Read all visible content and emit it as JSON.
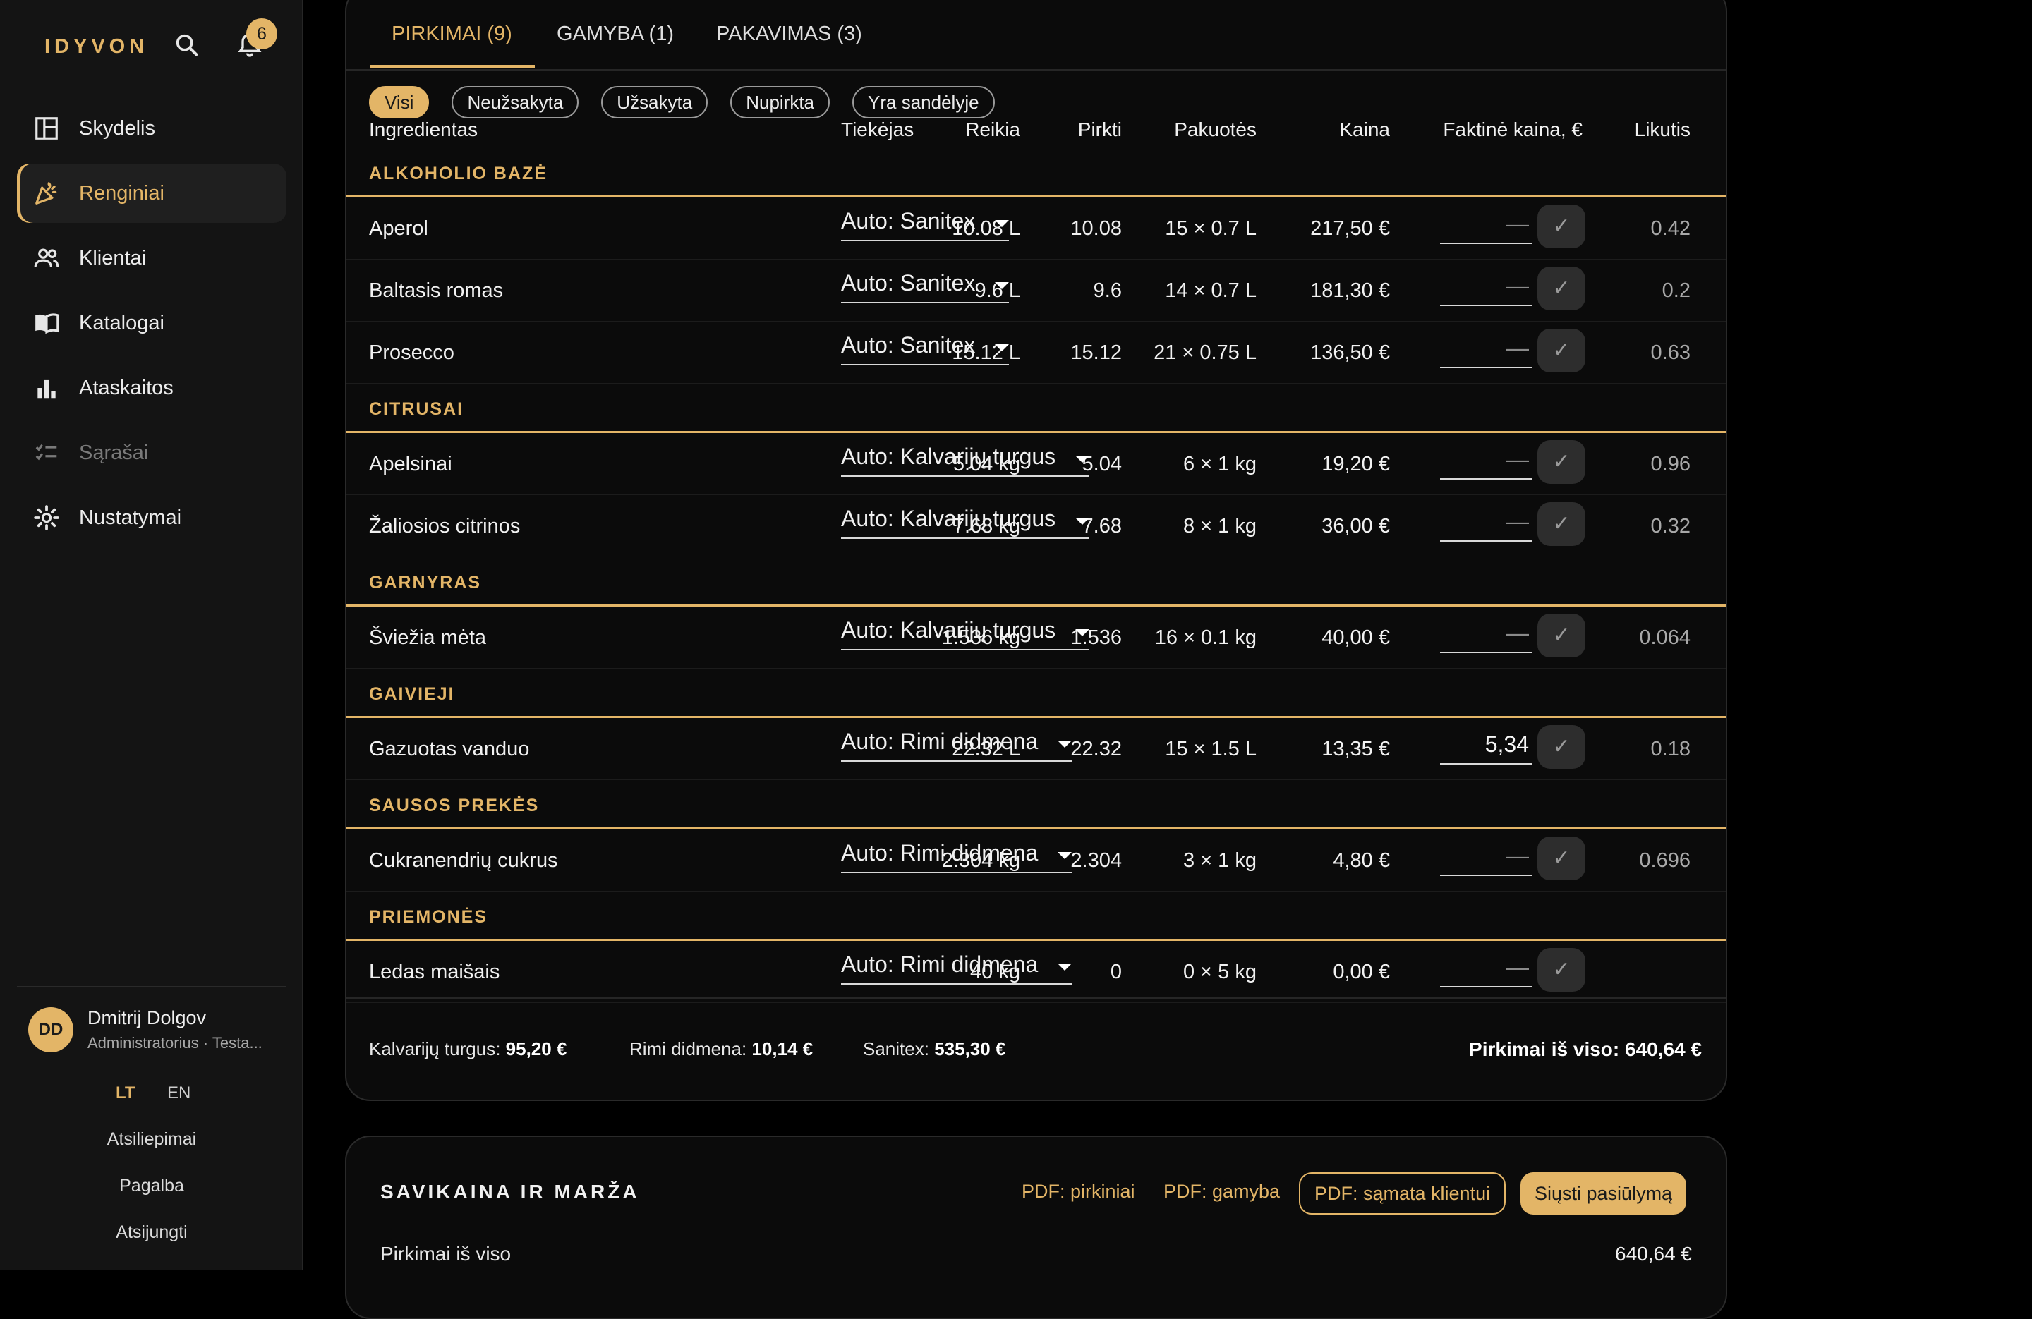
{
  "app": {
    "brand": "IDYVON",
    "notification_count": "6"
  },
  "sidebar": {
    "items": [
      {
        "label": "Skydelis",
        "icon": "dashboard-icon"
      },
      {
        "label": "Renginiai",
        "icon": "party-icon"
      },
      {
        "label": "Klientai",
        "icon": "users-icon"
      },
      {
        "label": "Katalogai",
        "icon": "book-icon"
      },
      {
        "label": "Ataskaitos",
        "icon": "bar-chart-icon"
      },
      {
        "label": "Sąrašai",
        "icon": "checklist-icon"
      },
      {
        "label": "Nustatymai",
        "icon": "gear-icon"
      }
    ],
    "active_index": 1,
    "disabled_index": 5
  },
  "user": {
    "initials": "DD",
    "name": "Dmitrij Dolgov",
    "role": "Administratorius · Testa..."
  },
  "lang": {
    "lt": "LT",
    "en": "EN",
    "active": "LT"
  },
  "links": {
    "feedback": "Atsiliepimai",
    "help": "Pagalba",
    "logout": "Atsijungti"
  },
  "tabs": [
    "PIRKIMAI (9)",
    "GAMYBA (1)",
    "PAKAVIMAS (3)"
  ],
  "filters": [
    "Visi",
    "Neužsakyta",
    "Užsakyta",
    "Nupirkta",
    "Yra sandėlyje"
  ],
  "table": {
    "headers": {
      "ingredient": "Ingredientas",
      "need": "Reikia",
      "buy": "Pirkti",
      "supplier": "Tiekėjas",
      "packs": "Pakuotės",
      "price": "Kaina",
      "actual": "Faktinė kaina, €",
      "rest": "Likutis"
    },
    "groups": [
      {
        "label": "ALKOHOLIO BAZĖ",
        "rows": [
          {
            "name": "Aperol",
            "need": "10.08 L",
            "buy": "10.08",
            "supplier": "Auto: Sanitex",
            "packs": "15 × 0.7 L",
            "price": "217,50 €",
            "actual": "—",
            "check": "✓",
            "rest": "0.42"
          },
          {
            "name": "Baltasis romas",
            "need": "9.6 L",
            "buy": "9.6",
            "supplier": "Auto: Sanitex",
            "packs": "14 × 0.7 L",
            "price": "181,30 €",
            "actual": "—",
            "check": "✓",
            "rest": "0.2"
          },
          {
            "name": "Prosecco",
            "need": "15.12 L",
            "buy": "15.12",
            "supplier": "Auto: Sanitex",
            "packs": "21 × 0.75 L",
            "price": "136,50 €",
            "actual": "—",
            "check": "✓",
            "rest": "0.63"
          }
        ]
      },
      {
        "label": "CITRUSAI",
        "rows": [
          {
            "name": "Apelsinai",
            "need": "5.04 kg",
            "buy": "5.04",
            "supplier": "Auto: Kalvarijų turgus",
            "packs": "6 × 1 kg",
            "price": "19,20 €",
            "actual": "—",
            "check": "✓",
            "rest": "0.96"
          },
          {
            "name": "Žaliosios citrinos",
            "need": "7.68 kg",
            "buy": "7.68",
            "supplier": "Auto: Kalvarijų turgus",
            "packs": "8 × 1 kg",
            "price": "36,00 €",
            "actual": "—",
            "check": "✓",
            "rest": "0.32"
          }
        ]
      },
      {
        "label": "GARNYRAS",
        "rows": [
          {
            "name": "Šviežia mėta",
            "need": "1.536 kg",
            "buy": "1.536",
            "supplier": "Auto: Kalvarijų turgus",
            "packs": "16 × 0.1 kg",
            "price": "40,00 €",
            "actual": "—",
            "check": "✓",
            "rest": "0.064"
          }
        ]
      },
      {
        "label": "GAIVIEJI",
        "rows": [
          {
            "name": "Gazuotas vanduo",
            "need": "22.32 L",
            "buy": "22.32",
            "supplier": "Auto: Rimi didmena",
            "packs": "15 × 1.5 L",
            "price": "13,35 €",
            "actual": "5,34",
            "check": "✓",
            "rest": "0.18"
          }
        ]
      },
      {
        "label": "SAUSOS PREKĖS",
        "rows": [
          {
            "name": "Cukranendrių cukrus",
            "need": "2.304 kg",
            "buy": "2.304",
            "supplier": "Auto: Rimi didmena",
            "packs": "3 × 1 kg",
            "price": "4,80 €",
            "actual": "—",
            "check": "✓",
            "rest": "0.696"
          }
        ]
      },
      {
        "label": "PRIEMONĖS",
        "rows": [
          {
            "name": "Ledas maišais",
            "need": "40 kg",
            "buy": "0",
            "supplier": "Auto: Rimi didmena",
            "packs": "0 × 5 kg",
            "price": "0,00 €",
            "actual": "—",
            "check": "✓",
            "rest": ""
          }
        ]
      }
    ]
  },
  "summary": {
    "kalvariju_label": "Kalvarijų turgus:",
    "kalvariju_value": "95,20 €",
    "rimi_label": "Rimi didmena:",
    "rimi_value": "10,14 €",
    "sanitex_label": "Sanitex:",
    "sanitex_value": "535,30 €",
    "total": "Pirkimai iš viso: 640,64 €"
  },
  "costs": {
    "title": "SAVIKAINA IR MARŽA",
    "pdf_purchases": "PDF: pirkiniai",
    "pdf_production": "PDF: gamyba",
    "pdf_estimate": "PDF: sąmata klientui",
    "send_offer": "Siųsti pasiūlymą",
    "purchases_label": "Pirkimai iš viso",
    "purchases_value": "640,64 €"
  },
  "colors": {
    "accent": "#e3b567",
    "background": "#000000",
    "sidebar": "#141414",
    "card": "#0b0b0b"
  }
}
